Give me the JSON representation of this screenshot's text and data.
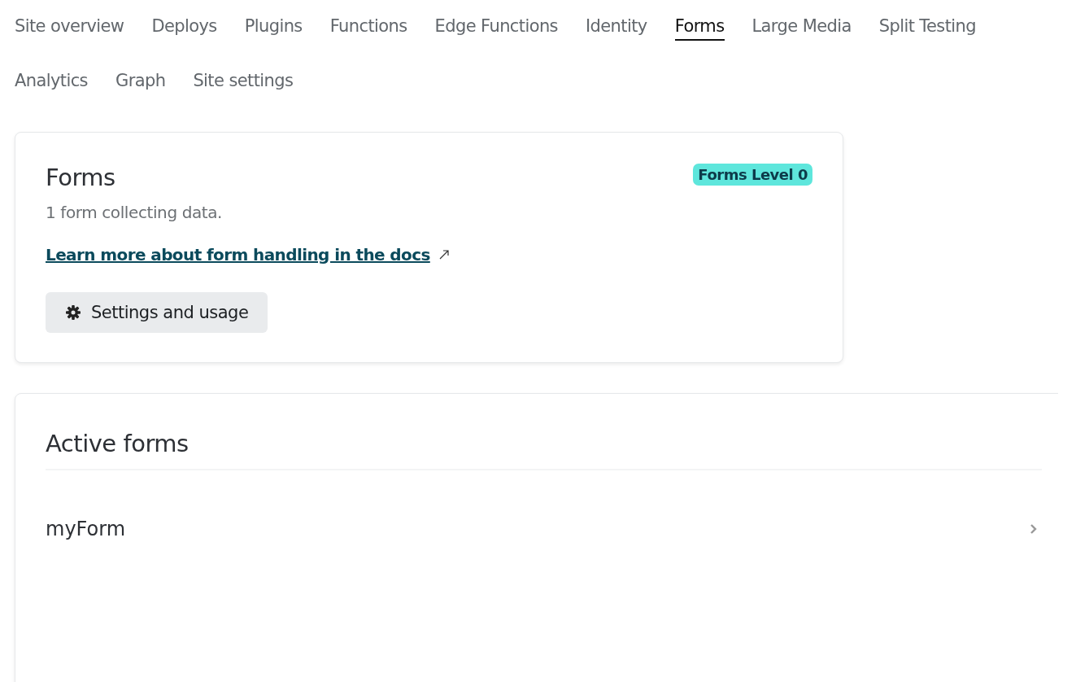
{
  "tabs": [
    {
      "label": "Site overview",
      "selected": false
    },
    {
      "label": "Deploys",
      "selected": false
    },
    {
      "label": "Plugins",
      "selected": false
    },
    {
      "label": "Functions",
      "selected": false
    },
    {
      "label": "Edge Functions",
      "selected": false
    },
    {
      "label": "Identity",
      "selected": false
    },
    {
      "label": "Forms",
      "selected": true
    },
    {
      "label": "Large Media",
      "selected": false
    },
    {
      "label": "Split Testing",
      "selected": false
    },
    {
      "label": "Analytics",
      "selected": false
    },
    {
      "label": "Graph",
      "selected": false
    },
    {
      "label": "Site settings",
      "selected": false
    }
  ],
  "forms_card": {
    "title": "Forms",
    "badge": "Forms Level 0",
    "description": "1 form collecting data.",
    "docs_link": "Learn more about form handling in the docs",
    "button": "Settings and usage"
  },
  "active_forms": {
    "title": "Active forms",
    "items": [
      {
        "name": "myForm"
      }
    ]
  }
}
